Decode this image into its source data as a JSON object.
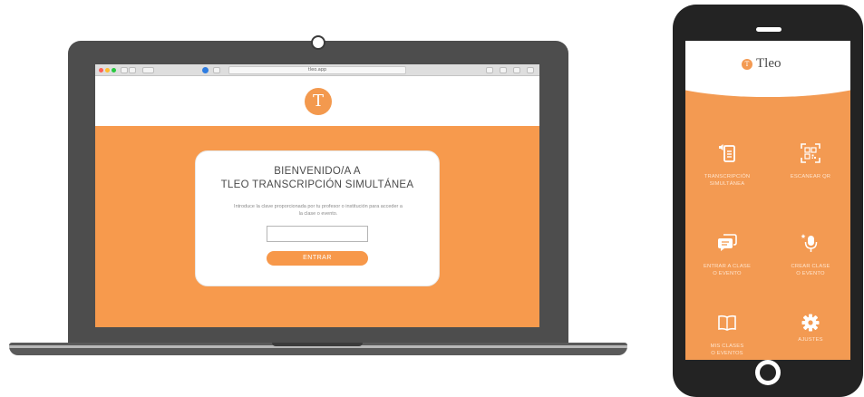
{
  "laptop": {
    "browser": {
      "url": "tleo.app"
    },
    "site": {
      "logo_letter": "T",
      "card": {
        "title_line1": "BIENVENIDO/A A",
        "title_line2": "TLEO TRANSCRIPCIÓN SIMULTÁNEA",
        "description": "Introduce la clave proporcionada por tu profesor o institución para acceder a la clase o evento.",
        "input_value": "",
        "enter_label": "ENTRAR"
      }
    }
  },
  "phone": {
    "app_logo_letter": "T",
    "app_name": "Tleo",
    "tiles": [
      {
        "label": "TRANSCRIPCIÓN\nSIMULTÁNEA",
        "icon": "transcription-icon"
      },
      {
        "label": "ESCANEAR QR",
        "icon": "qr-scan-icon"
      },
      {
        "label": "ENTRAR A CLASE\nO EVENTO",
        "icon": "chat-icon"
      },
      {
        "label": "CREAR CLASE\nO EVENTO",
        "icon": "microphone-icon"
      },
      {
        "label": "MIS CLASES\nO EVENTOS",
        "icon": "book-icon"
      },
      {
        "label": "AJUSTES",
        "icon": "gear-icon"
      }
    ]
  },
  "colors": {
    "brand_orange": "#f79a4d",
    "device_dark": "#4d4d4d",
    "phone_dark": "#232323"
  }
}
